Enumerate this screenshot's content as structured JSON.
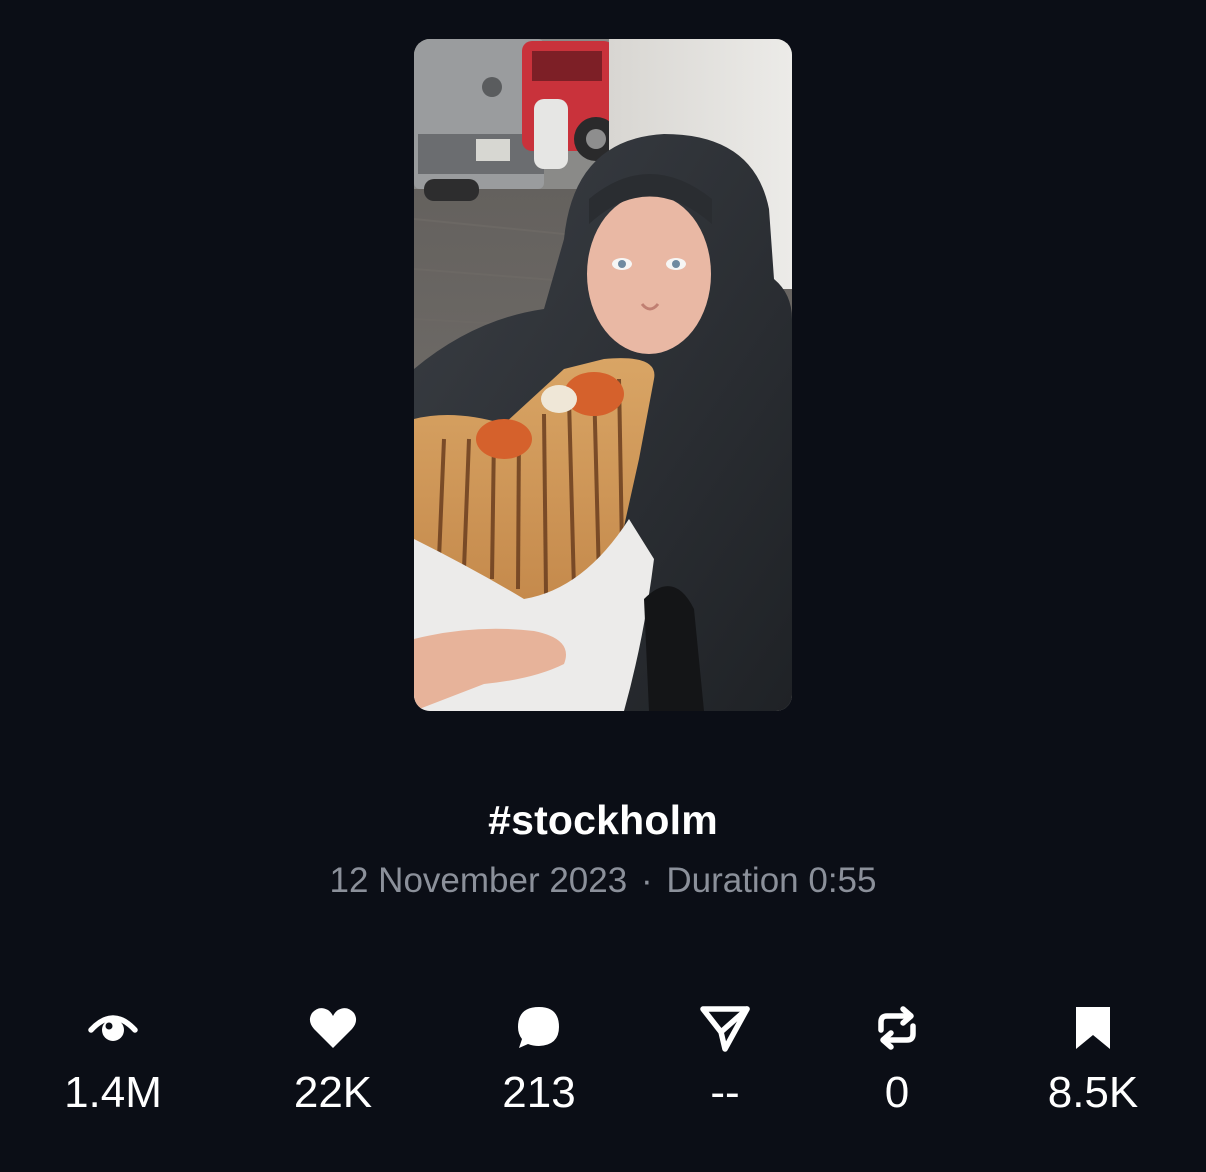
{
  "video": {
    "thumbnail_icon": "video-thumbnail",
    "title": "#stockholm",
    "date": "12 November 2023",
    "separator": "·",
    "duration": "Duration 0:55"
  },
  "stats": [
    {
      "name": "views",
      "icon": "eye-icon",
      "value": "1.4M"
    },
    {
      "name": "likes",
      "icon": "heart-icon",
      "value": "22K"
    },
    {
      "name": "comments",
      "icon": "comment-bubble-icon",
      "value": "213"
    },
    {
      "name": "shares",
      "icon": "send-icon",
      "value": "--"
    },
    {
      "name": "reposts",
      "icon": "repost-icon",
      "value": "0"
    },
    {
      "name": "saves",
      "icon": "bookmark-icon",
      "value": "8.5K"
    }
  ],
  "colors": {
    "background": "#0b0e16",
    "text": "#ffffff",
    "muted_text": "#8b909a"
  }
}
